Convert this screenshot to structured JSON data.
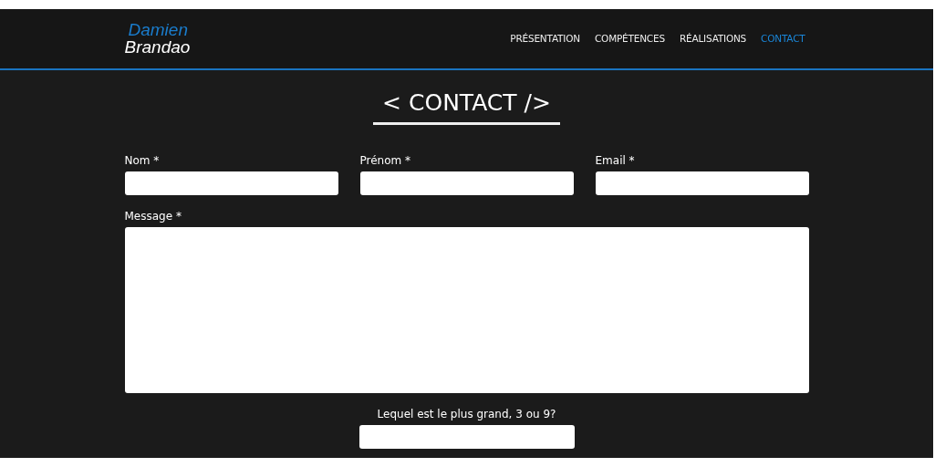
{
  "logo": {
    "first_name": "Damien",
    "last_name": "Brandao"
  },
  "nav": [
    {
      "label": "PRÉSENTATION",
      "selected": false
    },
    {
      "label": "COMPÉTENCES",
      "selected": false
    },
    {
      "label": "RÉALISATIONS",
      "selected": false
    },
    {
      "label": "CONTACT",
      "selected": true
    }
  ],
  "section_title": "< CONTACT />",
  "fields": [
    {
      "label": "Nom *"
    },
    {
      "label": "Prénom *"
    },
    {
      "label": "Email *"
    }
  ],
  "message": {
    "label": "Message *"
  },
  "captcha": {
    "question": "Lequel est le plus grand, 3 ou 9?"
  }
}
